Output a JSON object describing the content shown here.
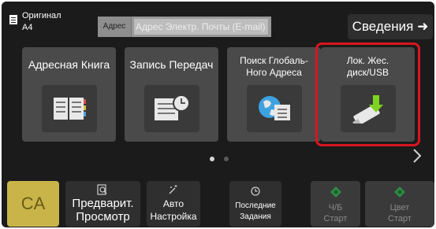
{
  "header": {
    "original_label": "Оригинал",
    "original_size": "A4",
    "address_label": "Адрес",
    "address_placeholder": "Адрес Электр. Почты (E-mail)",
    "details_label": "Сведения"
  },
  "tiles": [
    {
      "label": "Адресная Книга",
      "icon": "address-book-icon"
    },
    {
      "label": "Запись Передач",
      "icon": "transmission-log-icon"
    },
    {
      "label": "Поиск Глобаль-\nНого Адреса",
      "icon": "global-address-search-icon"
    },
    {
      "label": "Лок. Жес.\nдиск/USB",
      "icon": "usb-drive-icon"
    }
  ],
  "pager": {
    "pages": 2,
    "current": 1
  },
  "bottom": {
    "ca": "CA",
    "preview_line1": "Предварит.",
    "preview_line2": "Просмотр",
    "auto_line1": "Авто",
    "auto_line2": "Настройка",
    "last_line1": "Последние",
    "last_line2": "Задания",
    "bw_line1": "Ч/Б",
    "bw_line2": "Старт",
    "color_line1": "Цвет",
    "color_line2": "Старт"
  },
  "colors": {
    "highlight": "#d8161f",
    "ca": "#c9b44a",
    "start_icon": "#2ea44f",
    "usb_arrow": "#7ed321"
  }
}
